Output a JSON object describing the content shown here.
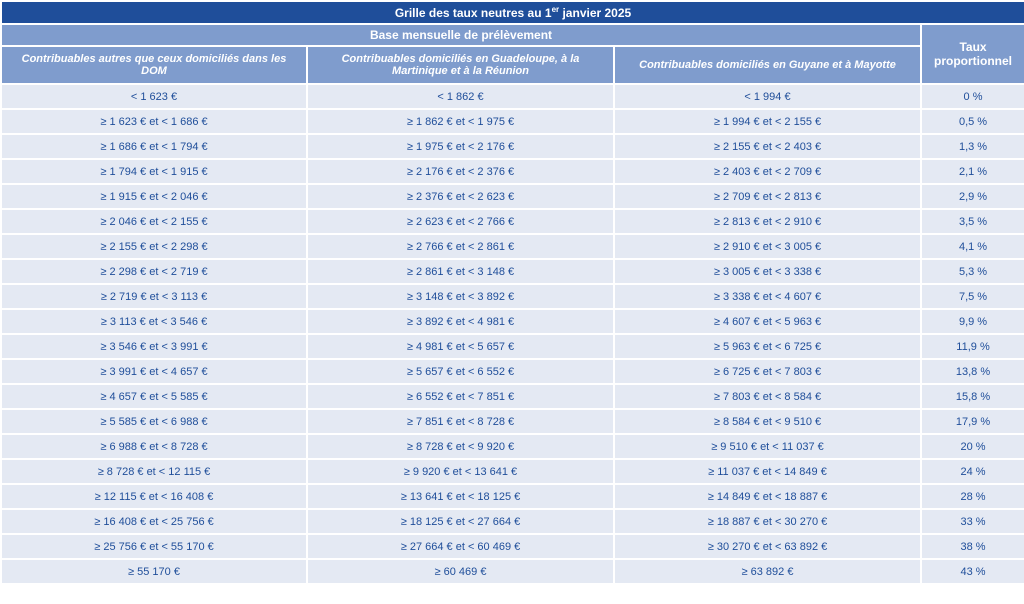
{
  "title": {
    "prefix": "Grille des taux neutres au 1",
    "superscript": "er",
    "suffix": " janvier 2025"
  },
  "header": {
    "base_label": "Base mensuelle de prélèvement",
    "taux_line1": "Taux",
    "taux_line2": "proportionnel",
    "columns": [
      "Contribuables autres que ceux domiciliés dans les DOM",
      "Contribuables domiciliés en Guadeloupe, à la Martinique et à la Réunion",
      "Contribuables domiciliés en Guyane et à Mayotte"
    ]
  },
  "rows": [
    [
      "< 1 623 €",
      "< 1 862 €",
      "< 1 994 €",
      "0 %"
    ],
    [
      "≥ 1 623 € et < 1 686 €",
      "≥ 1 862 € et < 1 975 €",
      "≥ 1 994 € et < 2 155 €",
      "0,5 %"
    ],
    [
      "≥ 1 686 € et < 1 794 €",
      "≥ 1 975 € et < 2 176 €",
      "≥ 2 155 € et < 2 403 €",
      "1,3 %"
    ],
    [
      "≥ 1 794 € et < 1 915 €",
      "≥ 2 176 € et < 2 376 €",
      "≥ 2 403 € et < 2 709 €",
      "2,1 %"
    ],
    [
      "≥ 1 915 € et < 2 046 €",
      "≥ 2 376 € et < 2 623 €",
      "≥ 2 709 € et < 2 813 €",
      "2,9 %"
    ],
    [
      "≥ 2 046 € et < 2 155 €",
      "≥ 2 623 € et < 2 766 €",
      "≥ 2 813 € et < 2 910 €",
      "3,5 %"
    ],
    [
      "≥ 2 155 € et < 2 298 €",
      "≥ 2 766 € et < 2 861 €",
      "≥ 2 910 € et < 3 005 €",
      "4,1 %"
    ],
    [
      "≥ 2 298 € et < 2 719 €",
      "≥ 2 861 € et < 3 148 €",
      "≥ 3 005 € et < 3 338 €",
      "5,3 %"
    ],
    [
      "≥ 2 719 € et < 3 113 €",
      "≥ 3 148 € et < 3 892 €",
      "≥ 3 338 € et < 4 607 €",
      "7,5 %"
    ],
    [
      "≥ 3 113 € et < 3 546 €",
      "≥ 3 892 € et < 4 981 €",
      "≥ 4 607 € et < 5 963 €",
      "9,9 %"
    ],
    [
      "≥ 3 546 € et < 3 991 €",
      "≥ 4 981 € et < 5 657 €",
      "≥ 5 963 € et < 6 725 €",
      "11,9 %"
    ],
    [
      "≥ 3 991 € et < 4 657 €",
      "≥ 5 657 € et < 6 552 €",
      "≥ 6 725 € et < 7 803 €",
      "13,8 %"
    ],
    [
      "≥ 4 657 € et < 5 585 €",
      "≥ 6 552 € et < 7 851 €",
      "≥ 7 803 € et < 8 584 €",
      "15,8 %"
    ],
    [
      "≥ 5 585 € et < 6 988 €",
      "≥ 7 851 € et < 8 728 €",
      "≥ 8 584 € et < 9 510 €",
      "17,9 %"
    ],
    [
      "≥ 6 988 € et < 8 728 €",
      "≥ 8 728 € et < 9 920 €",
      "≥ 9 510 € et < 11 037 €",
      "20 %"
    ],
    [
      "≥ 8 728 € et < 12 115 €",
      "≥ 9 920 € et < 13 641 €",
      "≥ 11 037 € et < 14 849 €",
      "24 %"
    ],
    [
      "≥ 12 115 € et < 16 408 €",
      "≥ 13 641 € et < 18 125 €",
      "≥ 14 849 € et < 18 887 €",
      "28 %"
    ],
    [
      "≥ 16 408 € et < 25 756 €",
      "≥ 18 125 € et < 27 664 €",
      "≥ 18 887 € et < 30 270 €",
      "33 %"
    ],
    [
      "≥ 25 756 € et < 55 170 €",
      "≥ 27 664 € et < 60 469 €",
      "≥ 30 270 € et < 63 892 €",
      "38 %"
    ],
    [
      "≥ 55 170 €",
      "≥ 60 469 €",
      "≥ 63 892 €",
      "43 %"
    ]
  ]
}
